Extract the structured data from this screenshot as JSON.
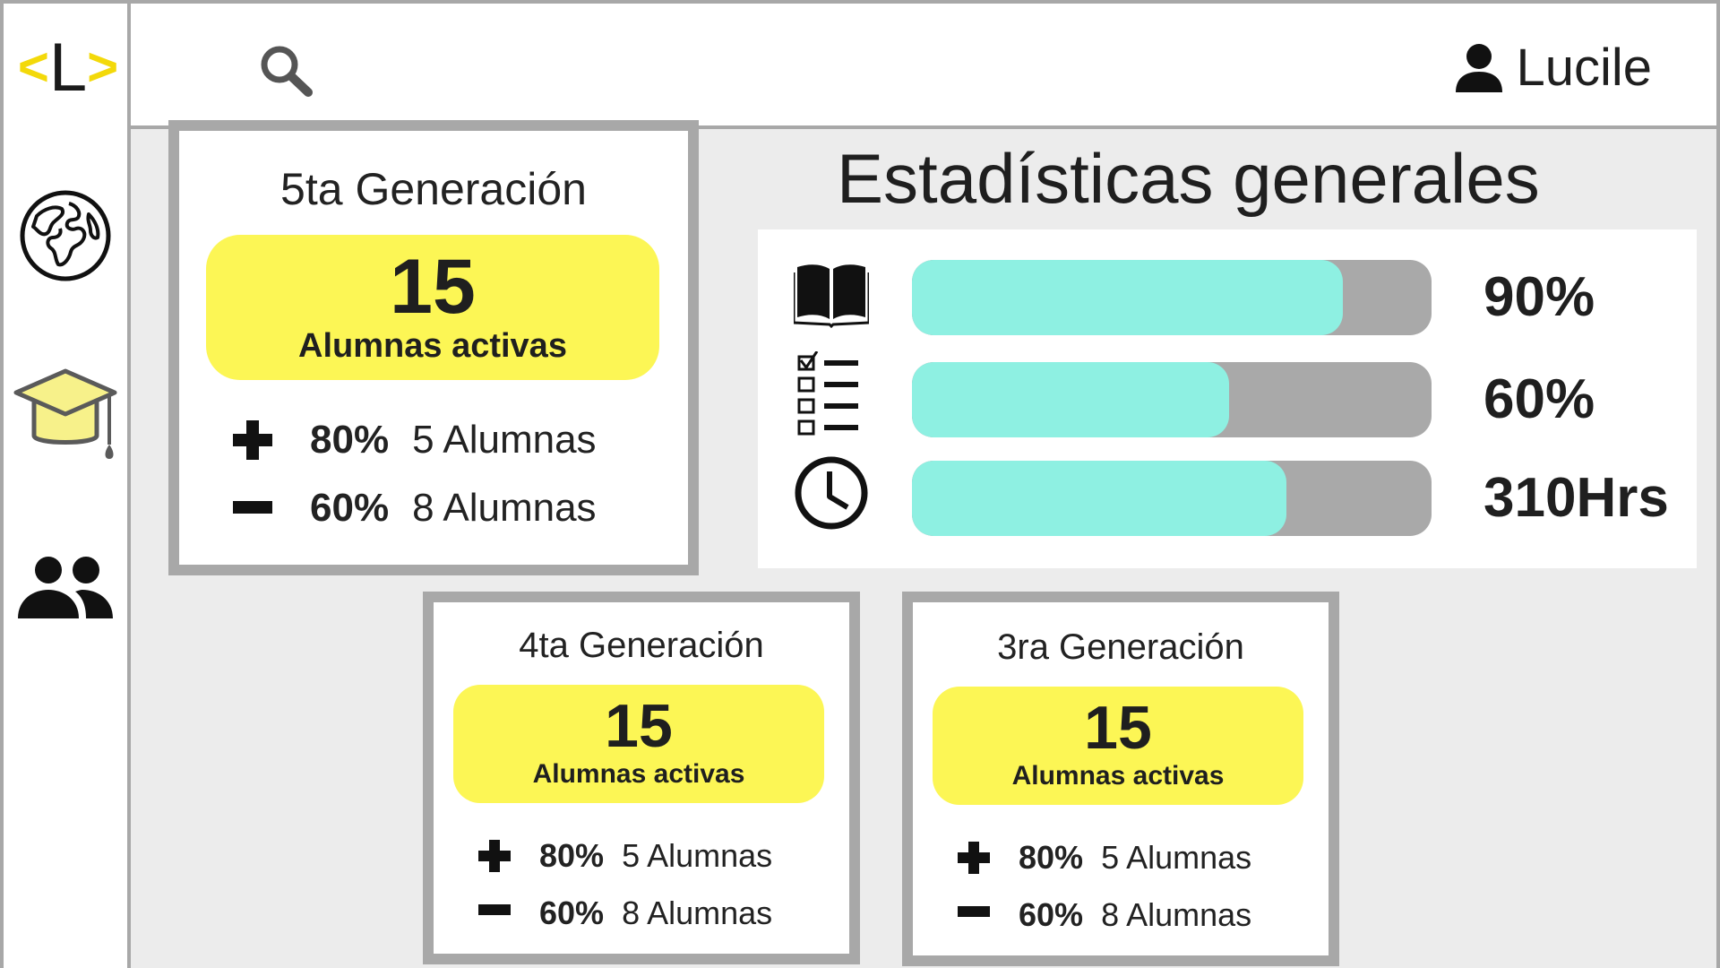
{
  "app": {
    "logo_letter": "L",
    "logo_left_bracket": "<",
    "logo_right_bracket": ">"
  },
  "header": {
    "user_name": "Lucile"
  },
  "sidebar": {
    "icons": [
      "globe-icon",
      "graduation-cap-icon",
      "people-icon"
    ]
  },
  "stats": {
    "title": "Estadísticas generales",
    "rows": [
      {
        "icon": "book-icon",
        "progress": 0.83,
        "value": "90%"
      },
      {
        "icon": "checklist-icon",
        "progress": 0.61,
        "value": "60%"
      },
      {
        "icon": "clock-icon",
        "progress": 0.72,
        "value": "310Hrs"
      }
    ]
  },
  "generations": [
    {
      "title": "5ta Generación",
      "count": "15",
      "count_label": "Alumnas activas",
      "plus_pct": "80%",
      "plus_text": "5 Alumnas",
      "minus_pct": "60%",
      "minus_text": "8 Alumnas"
    },
    {
      "title": "4ta Generación",
      "count": "15",
      "count_label": "Alumnas activas",
      "plus_pct": "80%",
      "plus_text": "5 Alumnas",
      "minus_pct": "60%",
      "minus_text": "8 Alumnas"
    },
    {
      "title": "3ra Generación",
      "count": "15",
      "count_label": "Alumnas activas",
      "plus_pct": "80%",
      "plus_text": "5 Alumnas",
      "minus_pct": "60%",
      "minus_text": "8 Alumnas"
    }
  ],
  "colors": {
    "accent_yellow": "#fcf655",
    "logo_yellow": "#f3d90a",
    "progress_fill": "#8ef0e2",
    "progress_track": "#a9a9a9",
    "card_border": "#a8a8a8",
    "content_bg": "#ececec"
  }
}
